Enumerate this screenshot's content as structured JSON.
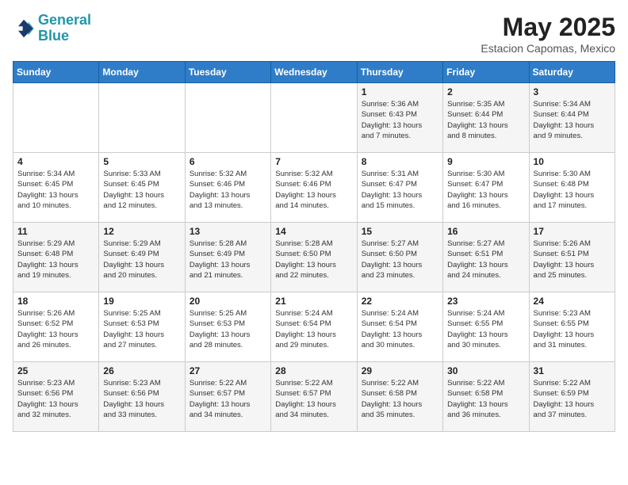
{
  "logo": {
    "line1": "General",
    "line2": "Blue"
  },
  "title": "May 2025",
  "location": "Estacion Capomas, Mexico",
  "days_of_week": [
    "Sunday",
    "Monday",
    "Tuesday",
    "Wednesday",
    "Thursday",
    "Friday",
    "Saturday"
  ],
  "weeks": [
    [
      {
        "day": "",
        "info": ""
      },
      {
        "day": "",
        "info": ""
      },
      {
        "day": "",
        "info": ""
      },
      {
        "day": "",
        "info": ""
      },
      {
        "day": "1",
        "info": "Sunrise: 5:36 AM\nSunset: 6:43 PM\nDaylight: 13 hours\nand 7 minutes."
      },
      {
        "day": "2",
        "info": "Sunrise: 5:35 AM\nSunset: 6:44 PM\nDaylight: 13 hours\nand 8 minutes."
      },
      {
        "day": "3",
        "info": "Sunrise: 5:34 AM\nSunset: 6:44 PM\nDaylight: 13 hours\nand 9 minutes."
      }
    ],
    [
      {
        "day": "4",
        "info": "Sunrise: 5:34 AM\nSunset: 6:45 PM\nDaylight: 13 hours\nand 10 minutes."
      },
      {
        "day": "5",
        "info": "Sunrise: 5:33 AM\nSunset: 6:45 PM\nDaylight: 13 hours\nand 12 minutes."
      },
      {
        "day": "6",
        "info": "Sunrise: 5:32 AM\nSunset: 6:46 PM\nDaylight: 13 hours\nand 13 minutes."
      },
      {
        "day": "7",
        "info": "Sunrise: 5:32 AM\nSunset: 6:46 PM\nDaylight: 13 hours\nand 14 minutes."
      },
      {
        "day": "8",
        "info": "Sunrise: 5:31 AM\nSunset: 6:47 PM\nDaylight: 13 hours\nand 15 minutes."
      },
      {
        "day": "9",
        "info": "Sunrise: 5:30 AM\nSunset: 6:47 PM\nDaylight: 13 hours\nand 16 minutes."
      },
      {
        "day": "10",
        "info": "Sunrise: 5:30 AM\nSunset: 6:48 PM\nDaylight: 13 hours\nand 17 minutes."
      }
    ],
    [
      {
        "day": "11",
        "info": "Sunrise: 5:29 AM\nSunset: 6:48 PM\nDaylight: 13 hours\nand 19 minutes."
      },
      {
        "day": "12",
        "info": "Sunrise: 5:29 AM\nSunset: 6:49 PM\nDaylight: 13 hours\nand 20 minutes."
      },
      {
        "day": "13",
        "info": "Sunrise: 5:28 AM\nSunset: 6:49 PM\nDaylight: 13 hours\nand 21 minutes."
      },
      {
        "day": "14",
        "info": "Sunrise: 5:28 AM\nSunset: 6:50 PM\nDaylight: 13 hours\nand 22 minutes."
      },
      {
        "day": "15",
        "info": "Sunrise: 5:27 AM\nSunset: 6:50 PM\nDaylight: 13 hours\nand 23 minutes."
      },
      {
        "day": "16",
        "info": "Sunrise: 5:27 AM\nSunset: 6:51 PM\nDaylight: 13 hours\nand 24 minutes."
      },
      {
        "day": "17",
        "info": "Sunrise: 5:26 AM\nSunset: 6:51 PM\nDaylight: 13 hours\nand 25 minutes."
      }
    ],
    [
      {
        "day": "18",
        "info": "Sunrise: 5:26 AM\nSunset: 6:52 PM\nDaylight: 13 hours\nand 26 minutes."
      },
      {
        "day": "19",
        "info": "Sunrise: 5:25 AM\nSunset: 6:53 PM\nDaylight: 13 hours\nand 27 minutes."
      },
      {
        "day": "20",
        "info": "Sunrise: 5:25 AM\nSunset: 6:53 PM\nDaylight: 13 hours\nand 28 minutes."
      },
      {
        "day": "21",
        "info": "Sunrise: 5:24 AM\nSunset: 6:54 PM\nDaylight: 13 hours\nand 29 minutes."
      },
      {
        "day": "22",
        "info": "Sunrise: 5:24 AM\nSunset: 6:54 PM\nDaylight: 13 hours\nand 30 minutes."
      },
      {
        "day": "23",
        "info": "Sunrise: 5:24 AM\nSunset: 6:55 PM\nDaylight: 13 hours\nand 30 minutes."
      },
      {
        "day": "24",
        "info": "Sunrise: 5:23 AM\nSunset: 6:55 PM\nDaylight: 13 hours\nand 31 minutes."
      }
    ],
    [
      {
        "day": "25",
        "info": "Sunrise: 5:23 AM\nSunset: 6:56 PM\nDaylight: 13 hours\nand 32 minutes."
      },
      {
        "day": "26",
        "info": "Sunrise: 5:23 AM\nSunset: 6:56 PM\nDaylight: 13 hours\nand 33 minutes."
      },
      {
        "day": "27",
        "info": "Sunrise: 5:22 AM\nSunset: 6:57 PM\nDaylight: 13 hours\nand 34 minutes."
      },
      {
        "day": "28",
        "info": "Sunrise: 5:22 AM\nSunset: 6:57 PM\nDaylight: 13 hours\nand 34 minutes."
      },
      {
        "day": "29",
        "info": "Sunrise: 5:22 AM\nSunset: 6:58 PM\nDaylight: 13 hours\nand 35 minutes."
      },
      {
        "day": "30",
        "info": "Sunrise: 5:22 AM\nSunset: 6:58 PM\nDaylight: 13 hours\nand 36 minutes."
      },
      {
        "day": "31",
        "info": "Sunrise: 5:22 AM\nSunset: 6:59 PM\nDaylight: 13 hours\nand 37 minutes."
      }
    ]
  ]
}
